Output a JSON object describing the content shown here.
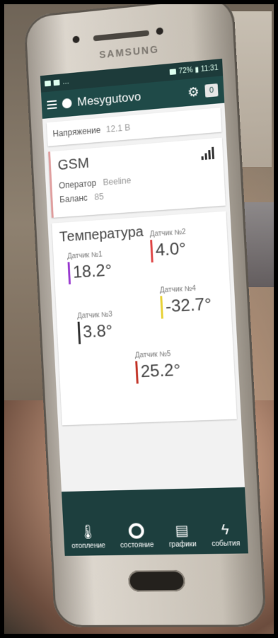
{
  "phone": {
    "brand": "SAMSUNG"
  },
  "statusbar": {
    "left": "…",
    "right": "72% ▮ 11:31"
  },
  "appbar": {
    "title": "Mesygutovo",
    "badge": "0"
  },
  "voltage": {
    "label": "Напряжение",
    "value": "12.1 В"
  },
  "gsm": {
    "title": "GSM",
    "operator_label": "Оператор",
    "operator_value": "Beeline",
    "balance_label": "Баланс",
    "balance_value": "85"
  },
  "temperature": {
    "title": "Температура",
    "sensors": [
      {
        "label": "Датчик №1",
        "value": "18.2°",
        "color": "#9b3fd0"
      },
      {
        "label": "Датчик №2",
        "value": "4.0°",
        "color": "#e04b4b"
      },
      {
        "label": "Датчик №3",
        "value": "3.8°",
        "color": "#333333"
      },
      {
        "label": "Датчик №4",
        "value": "-32.7°",
        "color": "#e8d23a"
      },
      {
        "label": "Датчик №5",
        "value": "25.2°",
        "color": "#c43a2e"
      }
    ]
  },
  "tabs": [
    {
      "label": "отопление",
      "icon": "thermometer-icon"
    },
    {
      "label": "состояние",
      "icon": "ring-icon"
    },
    {
      "label": "графики",
      "icon": "chart-icon"
    },
    {
      "label": "события",
      "icon": "lightning-icon"
    }
  ]
}
